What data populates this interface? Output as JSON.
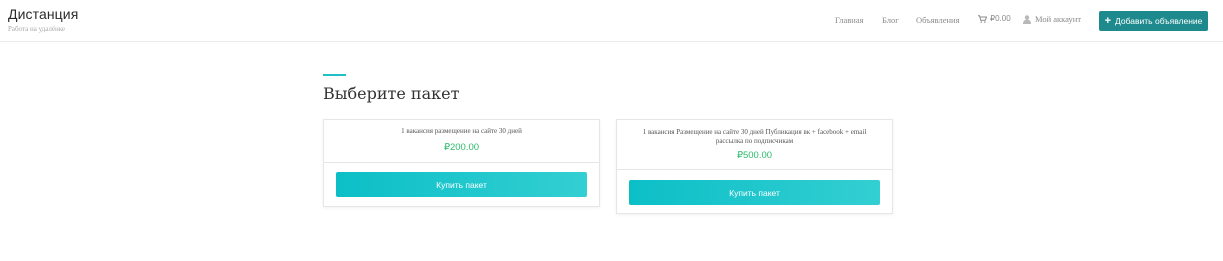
{
  "header": {
    "brand_title": "Дистанция",
    "brand_tagline": "Работа на удалёнке",
    "nav": {
      "home": "Главная",
      "blog": "Блог",
      "listings": "Объявления",
      "cart": "₽0.00",
      "account": "Мой аккаунт"
    },
    "add_button": "Добавить объявление"
  },
  "main": {
    "title": "Выберите пакет",
    "packages": [
      {
        "description": "1 вакансия размещение на сайте 30 дней",
        "price": "₽200.00",
        "button": "Купить пакет"
      },
      {
        "description": "1 вакансия Размещение на сайте 30 дней Публикация вк + facebook + email рассылка по подписчикам",
        "price": "₽500.00",
        "button": "Купить пакет"
      }
    ]
  },
  "colors": {
    "accent": "#1fc0c6",
    "add_button": "#1f8a8e",
    "price": "#2dbb6a"
  },
  "icons": [
    "cart-icon",
    "user-icon",
    "plus-icon"
  ]
}
